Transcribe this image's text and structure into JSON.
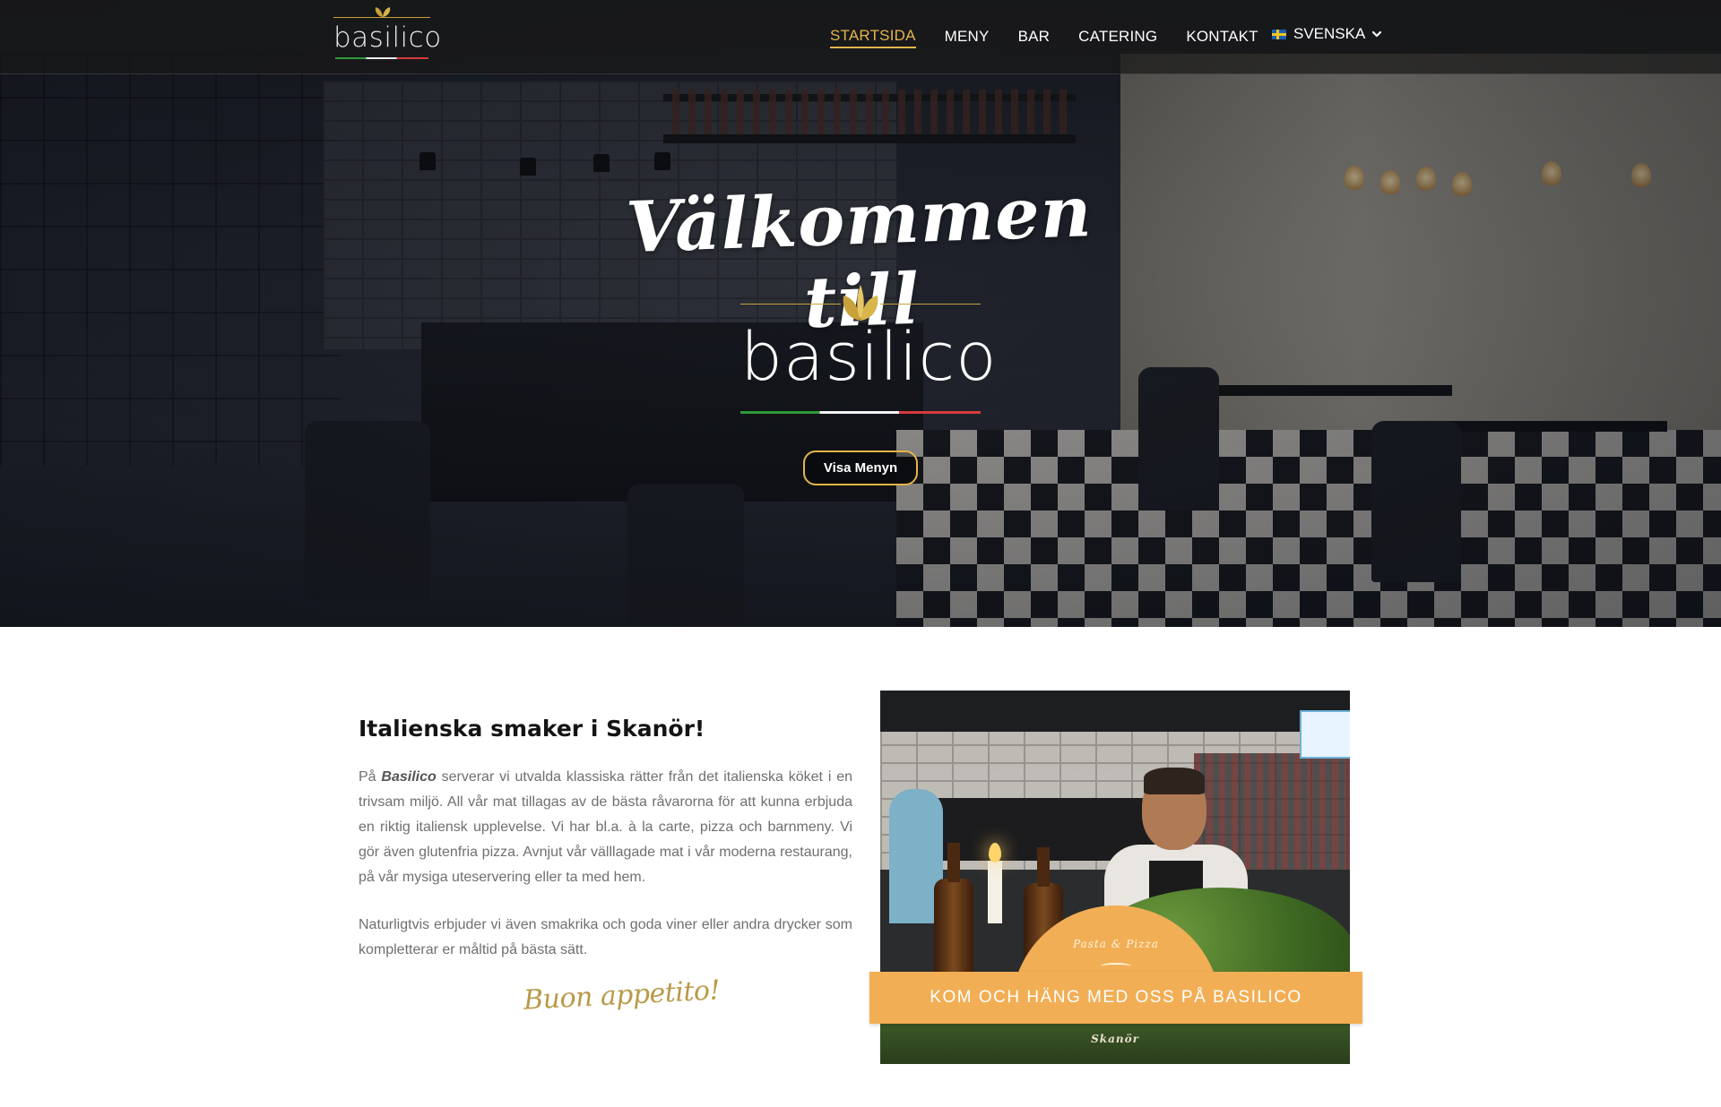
{
  "brand": {
    "logo_word": "basilico",
    "accent_gold": "#e3b54a",
    "flag_colors": [
      "#2e9b3a",
      "#f4f4f4",
      "#d63b3b"
    ]
  },
  "nav": {
    "items": [
      {
        "label": "STARTSIDA",
        "active": true
      },
      {
        "label": "MENY",
        "active": false
      },
      {
        "label": "BAR",
        "active": false
      },
      {
        "label": "CATERING",
        "active": false
      },
      {
        "label": "KONTAKT",
        "active": false
      }
    ],
    "language": {
      "label": "SVENSKA",
      "flag_icon": "sweden-flag-icon",
      "dropdown_icon": "chevron-down-icon"
    }
  },
  "hero": {
    "welcome": "Välkommen till",
    "logo_word": "basilico",
    "button_label": "Visa Menyn"
  },
  "intro": {
    "heading": "Italienska smaker i Skanör!",
    "p1_prefix": "På ",
    "p1_brand": "Basilico",
    "p1_rest": " serverar vi utvalda klassiska rätter från det italienska köket i en trivsam miljö. All vår mat tillagas av de bästa råvarorna för att kunna erbjuda en riktig italiensk upplevelse. Vi har bl.a. à la carte, pizza och barnmeny. Vi gör även glutenfria pizza. Avnjut vår välllagade mat i vår moderna restaurang, på vår mysiga uteservering eller ta med hem.",
    "p2": "Naturligtvis erbjuder vi även smakrika och goda viner eller andra drycker som kompletterar er måltid på bästa sätt.",
    "signature": "Buon appetito!"
  },
  "photo_card": {
    "dome_text": "Pasta & Pizza",
    "banner": "KOM OCH HÄNG MED OSS PÅ BASILICO",
    "footer": "Skanör",
    "banner_color": "#f2ae55"
  }
}
